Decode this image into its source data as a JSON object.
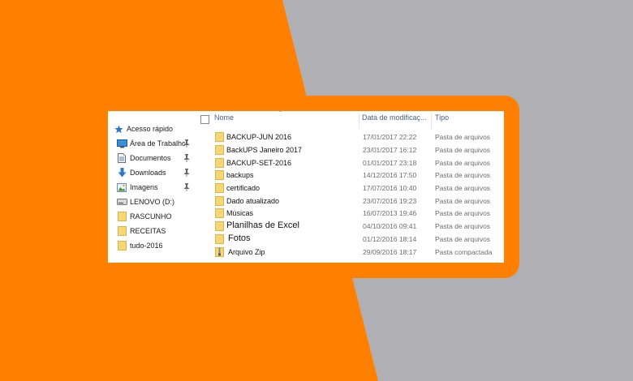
{
  "colors": {
    "orange": "#ff8000",
    "gray": "#b0b0b4",
    "folder": "#f7d774",
    "header_text": "#4d6082"
  },
  "nav": {
    "items": [
      {
        "label": "Acesso rápido",
        "icon": "star-icon",
        "pinned": false
      },
      {
        "label": "Área de Trabalho",
        "icon": "desktop-icon",
        "pinned": true
      },
      {
        "label": "Documentos",
        "icon": "document-icon",
        "pinned": true
      },
      {
        "label": "Downloads",
        "icon": "download-arrow-icon",
        "pinned": true
      },
      {
        "label": "Imagens",
        "icon": "image-icon",
        "pinned": true
      },
      {
        "label": "LENOVO (D:)",
        "icon": "drive-icon",
        "pinned": false
      },
      {
        "label": "RASCUNHO",
        "icon": "folder-icon",
        "pinned": false
      },
      {
        "label": "RECEITAS",
        "icon": "folder-icon",
        "pinned": false
      },
      {
        "label": "tudo-2016",
        "icon": "folder-icon",
        "pinned": false
      }
    ]
  },
  "columns": {
    "name": "Nome",
    "date": "Data de modificaç...",
    "type": "Tipo"
  },
  "files": [
    {
      "name": "BACKUP-JUN 2016",
      "date": "17/01/2017 22:22",
      "type": "Pasta de arquivos",
      "icon": "folder-icon"
    },
    {
      "name": "BackUPS Janeiro 2017",
      "date": "23/01/2017 16:12",
      "type": "Pasta de arquivos",
      "icon": "folder-icon"
    },
    {
      "name": "BACKUP-SET-2016",
      "date": "01/01/2017 23:18",
      "type": "Pasta de arquivos",
      "icon": "folder-icon"
    },
    {
      "name": "backups",
      "date": "14/12/2016 17:50",
      "type": "Pasta de arquivos",
      "icon": "folder-icon"
    },
    {
      "name": "certificado",
      "date": "17/07/2016 10:40",
      "type": "Pasta de arquivos",
      "icon": "folder-icon"
    },
    {
      "name": "Dado atualizado",
      "date": "23/07/2016 19:23",
      "type": "Pasta de arquivos",
      "icon": "folder-icon"
    },
    {
      "name": "Músicas",
      "date": "16/07/2013 19:46",
      "type": "Pasta de arquivos",
      "icon": "folder-icon"
    },
    {
      "name": "Planilhas de Excel",
      "date": "04/10/2016 09:41",
      "type": "Pasta de arquivos",
      "icon": "folder-icon"
    },
    {
      "name": "Fotos",
      "date": "01/12/2016 18:14",
      "type": "Pasta de arquivos",
      "icon": "folder-icon"
    },
    {
      "name": "Arquivo Zip",
      "date": "29/09/2016 18:17",
      "type": "Pasta compactada",
      "icon": "zip-folder-icon"
    }
  ]
}
